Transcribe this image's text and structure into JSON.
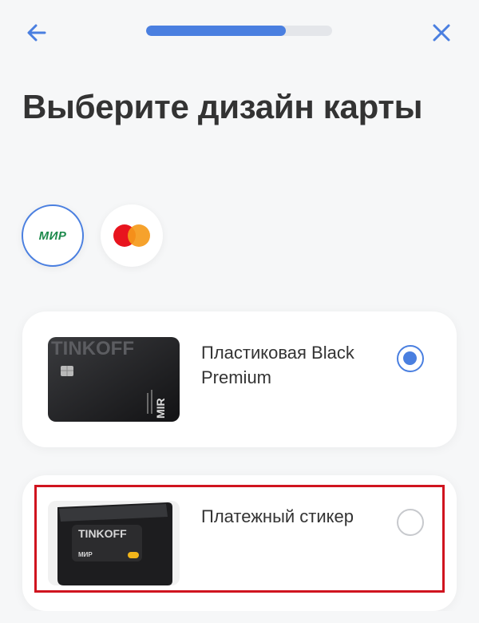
{
  "header": {
    "back_icon": "arrow-left-icon",
    "close_icon": "close-icon",
    "progress": 0.75,
    "accent": "#4a7fe0"
  },
  "title": "Выберите дизайн карты",
  "payment_systems": [
    {
      "name": "МИР",
      "icon": "mir-logo",
      "selected": true
    },
    {
      "name": "Mastercard",
      "icon": "mastercard-logo",
      "selected": false
    }
  ],
  "card_options": [
    {
      "label": "Пластиковая Black Premium",
      "image_text": "TINKOFF",
      "mark": "MIR",
      "selected": true
    },
    {
      "label": "Платежный стикер",
      "image_text": "TINKOFF",
      "mark": "МИР",
      "selected": false
    }
  ],
  "colors": {
    "highlight": "#d0141f",
    "mir_green": "#1e8a4c",
    "mc_red": "#e8141e",
    "mc_orange": "#f59a1a"
  }
}
